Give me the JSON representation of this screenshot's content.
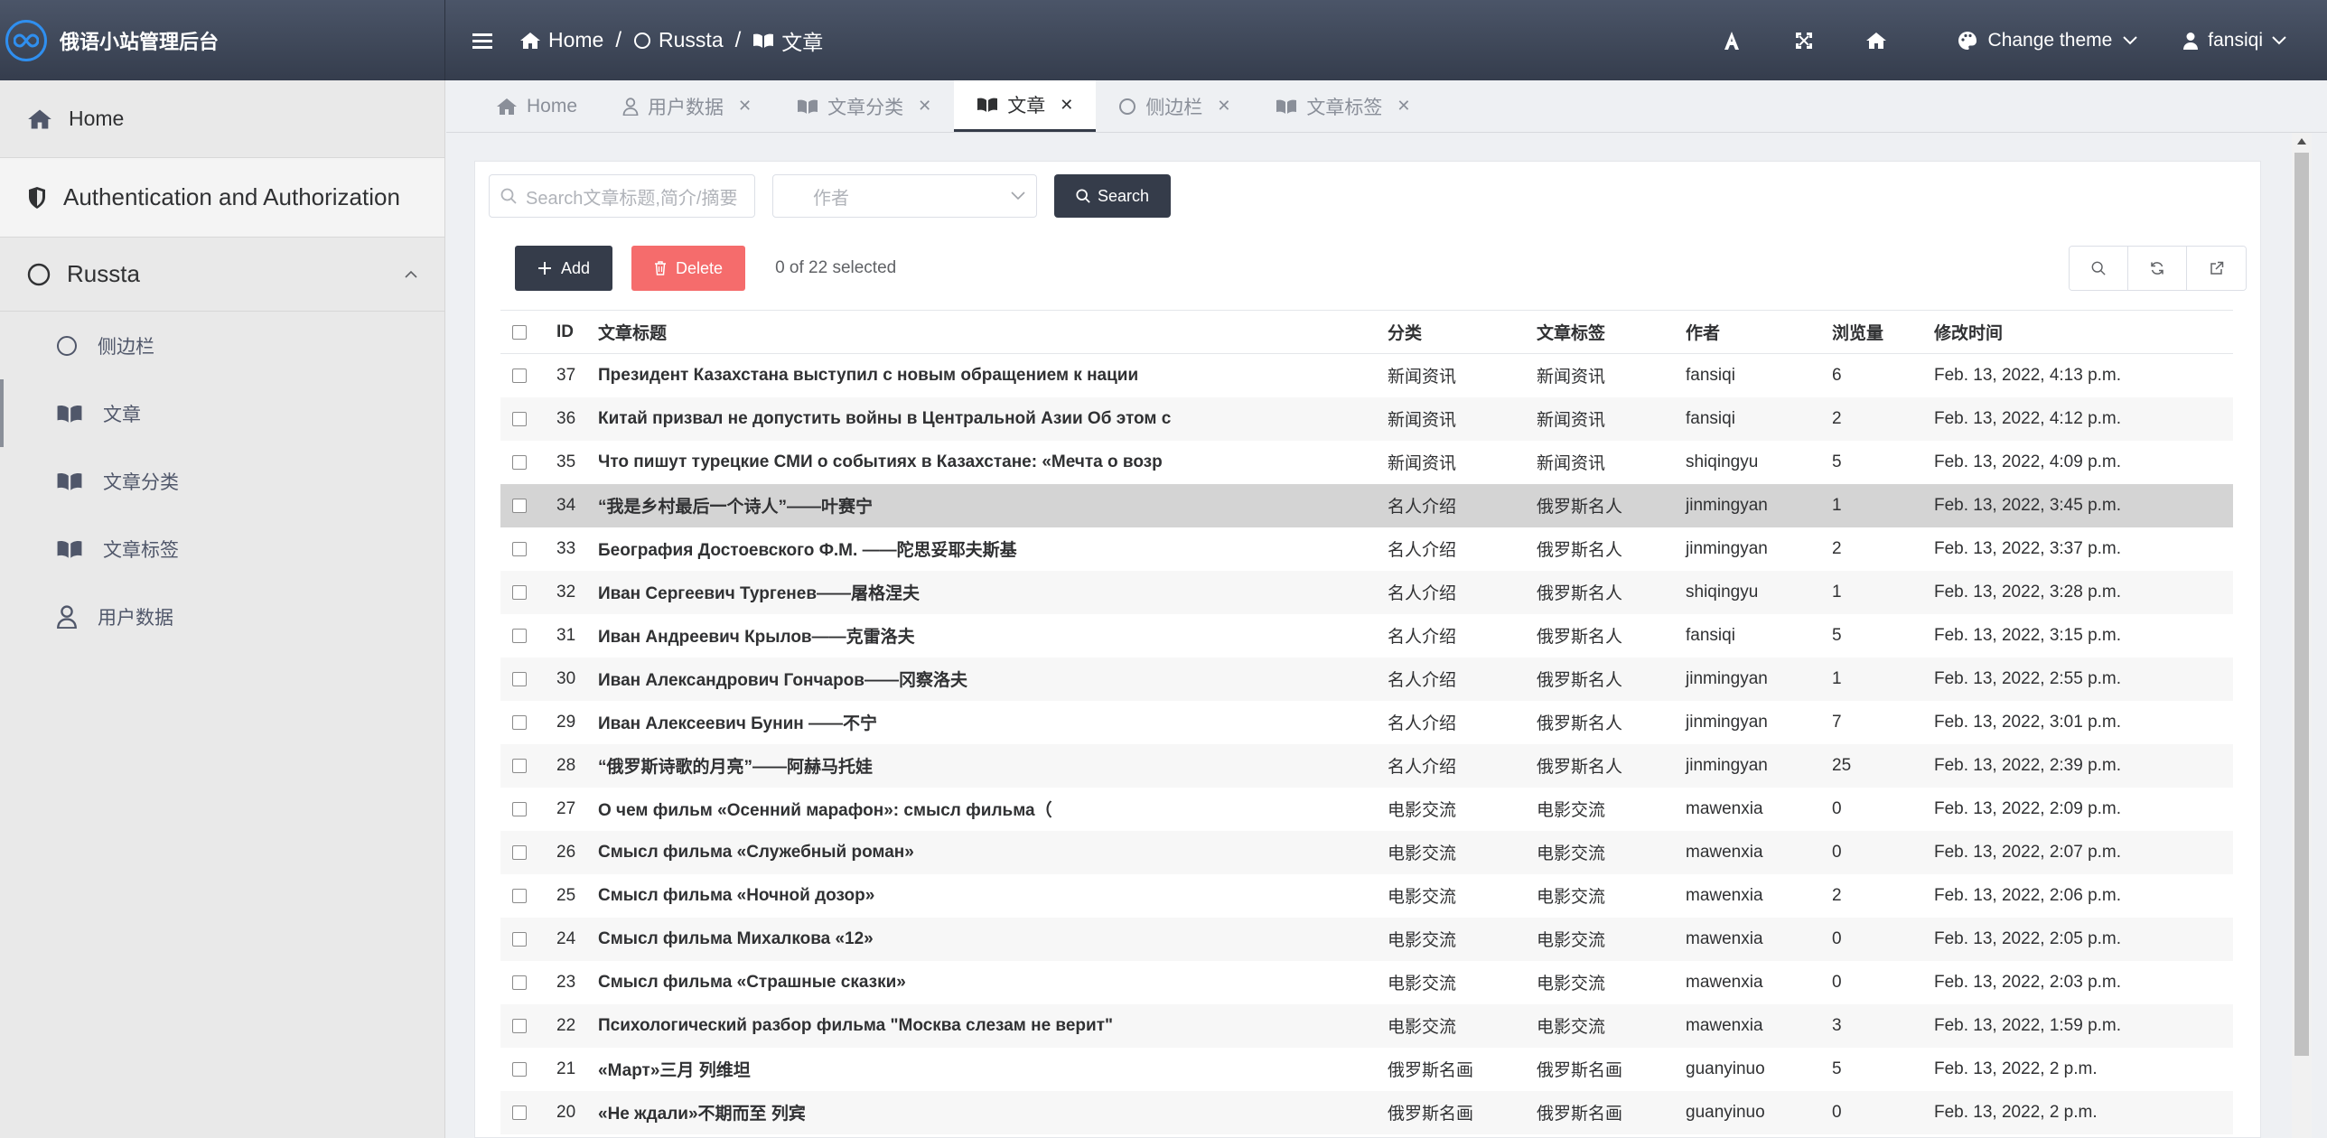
{
  "app": {
    "title": "俄语小站管理后台"
  },
  "colors": {
    "primary": "#353c4a",
    "danger": "#f56c6c",
    "logo_ring": "#2f8ff0"
  },
  "breadcrumb": {
    "home": "Home",
    "sep": "/",
    "section": "Russta",
    "page": "文章"
  },
  "header_tools": {
    "theme_label": "Change theme",
    "user": "fansiqi"
  },
  "sidebar": {
    "home": "Home",
    "auth": "Authentication and Authorization",
    "group": "Russta",
    "items": [
      "侧边栏",
      "文章",
      "文章分类",
      "文章标签",
      "用户数据"
    ]
  },
  "tabs": [
    {
      "label": "Home",
      "icon": "home-icon"
    },
    {
      "label": "用户数据",
      "icon": "user-icon"
    },
    {
      "label": "文章分类",
      "icon": "book-icon"
    },
    {
      "label": "文章",
      "icon": "book-icon"
    },
    {
      "label": "侧边栏",
      "icon": "circle-icon"
    },
    {
      "label": "文章标签",
      "icon": "book-icon"
    }
  ],
  "filters": {
    "search_placeholder": "Search文章标题,简介/摘要",
    "author_placeholder": "作者",
    "search_button": "Search"
  },
  "actions": {
    "add": "Add",
    "delete": "Delete",
    "selection": "0 of 22 selected"
  },
  "table": {
    "headers": {
      "id": "ID",
      "title": "文章标题",
      "category": "分类",
      "tag": "文章标签",
      "author": "作者",
      "views": "浏览量",
      "modified": "修改时间"
    },
    "rows": [
      {
        "id": "37",
        "title": "Президент Казахстана выступил с новым обращением к нации",
        "category": "新闻资讯",
        "tag": "新闻资讯",
        "author": "fansiqi",
        "views": "6",
        "modified": "Feb. 13, 2022, 4:13 p.m."
      },
      {
        "id": "36",
        "title": "Китай призвал не допустить войны в Центральной Азии Об этом с",
        "category": "新闻资讯",
        "tag": "新闻资讯",
        "author": "fansiqi",
        "views": "2",
        "modified": "Feb. 13, 2022, 4:12 p.m."
      },
      {
        "id": "35",
        "title": "Что пишут турецкие СМИ о событиях в Казахстане: «Мечта о возр",
        "category": "新闻资讯",
        "tag": "新闻资讯",
        "author": "shiqingyu",
        "views": "5",
        "modified": "Feb. 13, 2022, 4:09 p.m."
      },
      {
        "id": "34",
        "title": "“我是乡村最后一个诗人”——叶赛宁",
        "category": "名人介绍",
        "tag": "俄罗斯名人",
        "author": "jinmingyan",
        "views": "1",
        "modified": "Feb. 13, 2022, 3:45 p.m."
      },
      {
        "id": "33",
        "title": "Беография Достоевского Ф.М. ——陀思妥耶夫斯基",
        "category": "名人介绍",
        "tag": "俄罗斯名人",
        "author": "jinmingyan",
        "views": "2",
        "modified": "Feb. 13, 2022, 3:37 p.m."
      },
      {
        "id": "32",
        "title": "Иван Сергеевич Тургенев——屠格涅夫",
        "category": "名人介绍",
        "tag": "俄罗斯名人",
        "author": "shiqingyu",
        "views": "1",
        "modified": "Feb. 13, 2022, 3:28 p.m."
      },
      {
        "id": "31",
        "title": "Иван Андреевич Крылов——克雷洛夫",
        "category": "名人介绍",
        "tag": "俄罗斯名人",
        "author": "fansiqi",
        "views": "5",
        "modified": "Feb. 13, 2022, 3:15 p.m."
      },
      {
        "id": "30",
        "title": "Иван Александрович Гончаров——冈察洛夫",
        "category": "名人介绍",
        "tag": "俄罗斯名人",
        "author": "jinmingyan",
        "views": "1",
        "modified": "Feb. 13, 2022, 2:55 p.m."
      },
      {
        "id": "29",
        "title": "Иван Алексеевич Бунин ——不宁",
        "category": "名人介绍",
        "tag": "俄罗斯名人",
        "author": "jinmingyan",
        "views": "7",
        "modified": "Feb. 13, 2022, 3:01 p.m."
      },
      {
        "id": "28",
        "title": "“俄罗斯诗歌的月亮”——阿赫马托娃",
        "category": "名人介绍",
        "tag": "俄罗斯名人",
        "author": "jinmingyan",
        "views": "25",
        "modified": "Feb. 13, 2022, 2:39 p.m."
      },
      {
        "id": "27",
        "title": "О чем фильм «Осенний марафон»: смысл фильма（",
        "category": "电影交流",
        "tag": "电影交流",
        "author": "mawenxia",
        "views": "0",
        "modified": "Feb. 13, 2022, 2:09 p.m."
      },
      {
        "id": "26",
        "title": "Смысл фильма «Служебный роман»",
        "category": "电影交流",
        "tag": "电影交流",
        "author": "mawenxia",
        "views": "0",
        "modified": "Feb. 13, 2022, 2:07 p.m."
      },
      {
        "id": "25",
        "title": "Смысл фильма «Ночной дозор»",
        "category": "电影交流",
        "tag": "电影交流",
        "author": "mawenxia",
        "views": "2",
        "modified": "Feb. 13, 2022, 2:06 p.m."
      },
      {
        "id": "24",
        "title": "Смысл фильма Михалкова «12»",
        "category": "电影交流",
        "tag": "电影交流",
        "author": "mawenxia",
        "views": "0",
        "modified": "Feb. 13, 2022, 2:05 p.m."
      },
      {
        "id": "23",
        "title": "Смысл фильма «Страшные сказки»",
        "category": "电影交流",
        "tag": "电影交流",
        "author": "mawenxia",
        "views": "0",
        "modified": "Feb. 13, 2022, 2:03 p.m."
      },
      {
        "id": "22",
        "title": "Психологический разбор фильма \"Москва слезам не верит\"",
        "category": "电影交流",
        "tag": "电影交流",
        "author": "mawenxia",
        "views": "3",
        "modified": "Feb. 13, 2022, 1:59 p.m."
      },
      {
        "id": "21",
        "title": "«Март»三月 列维坦",
        "category": "俄罗斯名画",
        "tag": "俄罗斯名画",
        "author": "guanyinuo",
        "views": "5",
        "modified": "Feb. 13, 2022, 2 p.m."
      },
      {
        "id": "20",
        "title": "«Не ждали»不期而至 列宾",
        "category": "俄罗斯名画",
        "tag": "俄罗斯名画",
        "author": "guanyinuo",
        "views": "0",
        "modified": "Feb. 13, 2022, 2 p.m."
      }
    ]
  }
}
